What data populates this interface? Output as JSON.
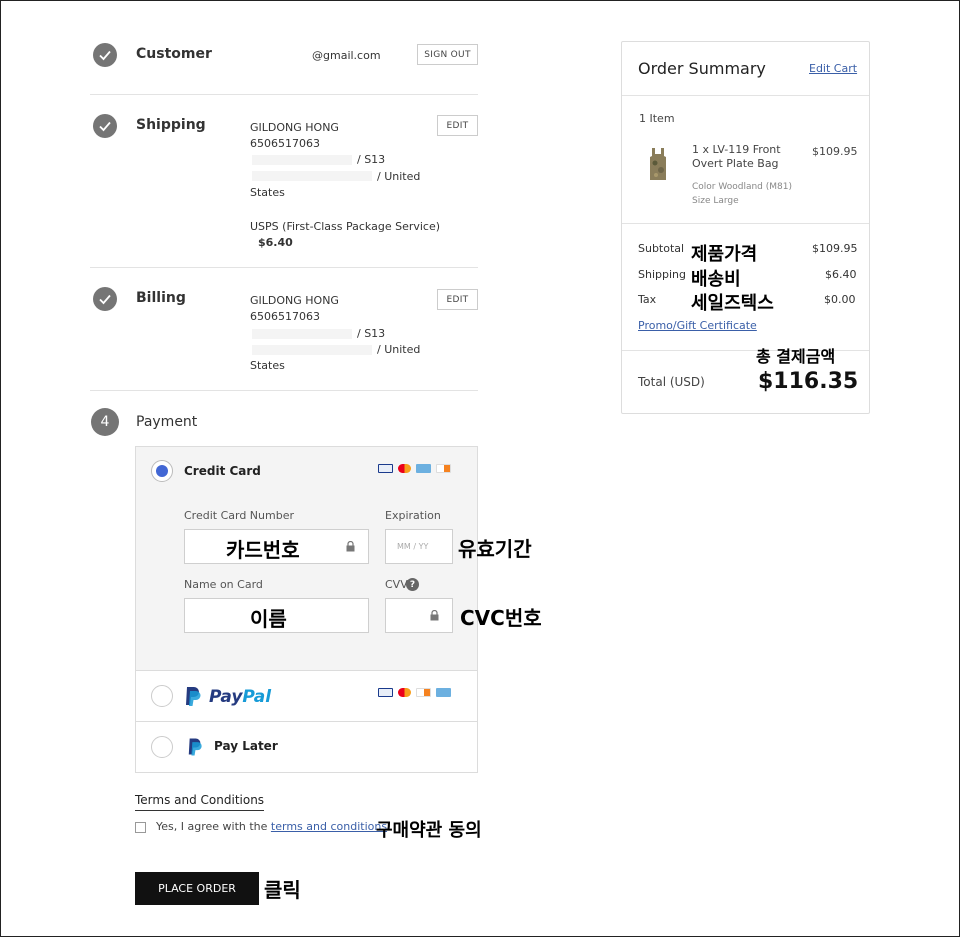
{
  "customer": {
    "title": "Customer",
    "email": "@gmail.com",
    "sign_out": "SIGN OUT"
  },
  "shipping": {
    "title": "Shipping",
    "name": "GILDONG HONG",
    "phone": "6506517063",
    "line1": "/ S13",
    "line2": "/ United",
    "line3": "States",
    "method": "USPS (First-Class Package Service)",
    "price": "$6.40",
    "edit": "EDIT"
  },
  "billing": {
    "title": "Billing",
    "name": "GILDONG HONG",
    "phone": "6506517063",
    "line1": "/ S13",
    "line2": "/ United",
    "line3": "States",
    "edit": "EDIT"
  },
  "payment": {
    "step": "4",
    "title": "Payment",
    "credit_card": {
      "label": "Credit Card",
      "card_number_label": "Credit Card Number",
      "expiration_label": "Expiration",
      "expiration_placeholder": "MM / YY",
      "name_label": "Name on Card",
      "cvv_label": "CVV",
      "card_number_annotation": "카드번호",
      "expiration_annotation": "유효기간",
      "name_annotation": "이름",
      "cvv_annotation": "CVC번호"
    },
    "paypal": {
      "label_pay": "Pay",
      "label_pal": "Pal"
    },
    "pay_later": {
      "label": "Pay Later"
    }
  },
  "terms": {
    "title": "Terms and Conditions",
    "agree_prefix": "Yes, I agree with the ",
    "agree_link": "terms and conditions",
    "annotation": "구매약관 동의"
  },
  "place_order": {
    "label": "PLACE ORDER",
    "annotation": "클릭"
  },
  "summary": {
    "title": "Order Summary",
    "edit_cart": "Edit Cart",
    "item_count": "1 Item",
    "item": {
      "name_line1": "1 x LV-119 Front",
      "name_line2": "Overt Plate Bag",
      "price": "$109.95",
      "color": "Color Woodland (M81)",
      "size": "Size Large"
    },
    "subtotal_label": "Subtotal",
    "subtotal_value": "$109.95",
    "subtotal_annotation": "제품가격",
    "shipping_label": "Shipping",
    "shipping_value": "$6.40",
    "shipping_annotation": "배송비",
    "tax_label": "Tax",
    "tax_value": "$0.00",
    "tax_annotation": "세일즈텍스",
    "promo": "Promo/Gift Certificate",
    "total_annotation": "총 결제금액",
    "total_label": "Total (USD)",
    "total_value": "$116.35"
  },
  "colors": {
    "accent_blue": "#4267d4",
    "link": "#3a5fa8",
    "paypal_dark": "#253b80",
    "paypal_light": "#179bd7",
    "button_dark": "#111111",
    "check_grey": "#757575"
  }
}
